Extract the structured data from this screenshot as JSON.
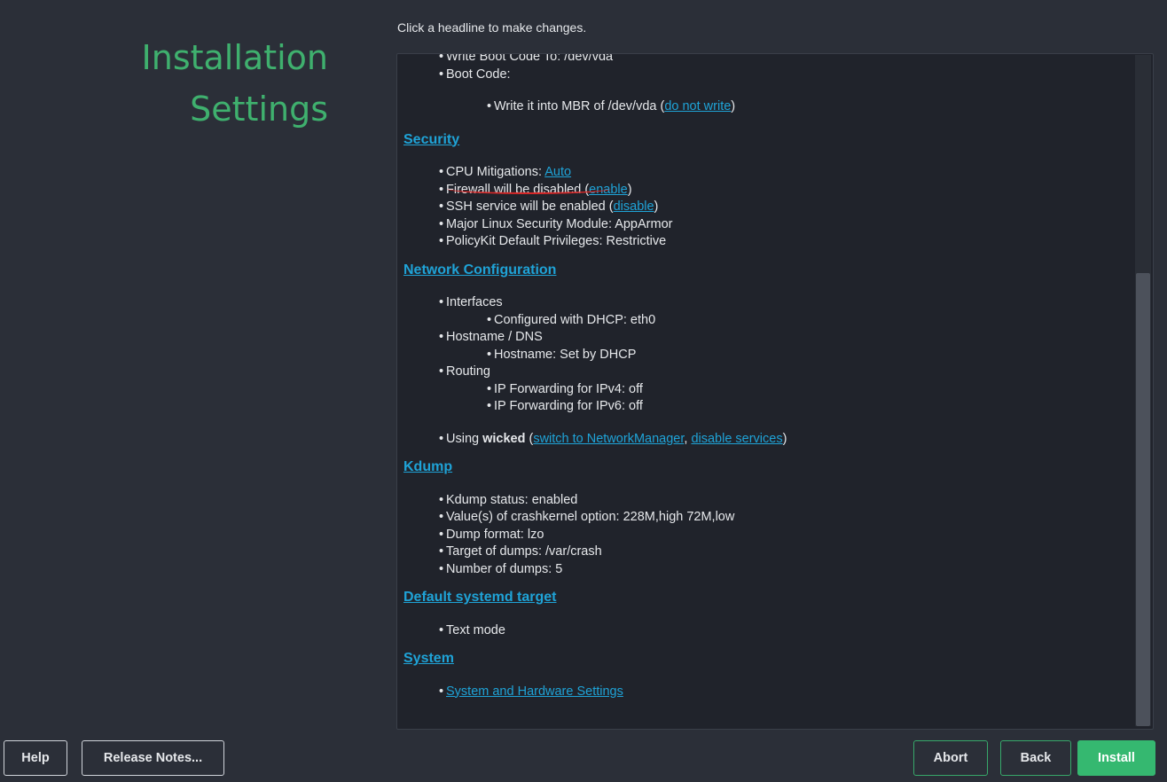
{
  "title": {
    "line1": "Installation",
    "line2": "Settings"
  },
  "hint": "Click a headline to make changes.",
  "boot": {
    "item1": "Write Boot Code To: /dev/vda",
    "item2": "Boot Code:",
    "mbr_prefix": "Write it into MBR of /dev/vda (",
    "mbr_link": "do not write",
    "mbr_suffix": ")"
  },
  "security": {
    "heading": "Security",
    "cpu_prefix": "CPU Mitigations: ",
    "cpu_link": "Auto",
    "firewall_prefix": "Firewall will be disabled (",
    "firewall_link": "enable",
    "firewall_suffix": ")",
    "ssh_prefix": "SSH service will be enabled (",
    "ssh_link": "disable",
    "ssh_suffix": ")",
    "lsm": "Major Linux Security Module: AppArmor",
    "polkit": "PolicyKit Default Privileges: Restrictive"
  },
  "network": {
    "heading": "Network Configuration",
    "interfaces": "Interfaces",
    "dhcp": "Configured with DHCP: eth0",
    "hostname_dns": "Hostname / DNS",
    "hostname": "Hostname: Set by DHCP",
    "routing": "Routing",
    "ipv4": "IP Forwarding for IPv4: off",
    "ipv6": "IP Forwarding for IPv6: off",
    "using_prefix": "Using ",
    "using_bold": "wicked",
    "using_open": " (",
    "link_nm": "switch to NetworkManager",
    "comma": ", ",
    "link_disable": "disable services",
    "using_close": ")"
  },
  "kdump": {
    "heading": "Kdump",
    "items": [
      "Kdump status: enabled",
      "Value(s) of crashkernel option: 228M,high 72M,low",
      "Dump format: lzo",
      "Target of dumps: /var/crash",
      "Number of dumps: 5"
    ]
  },
  "systemd": {
    "heading": "Default systemd target",
    "item": "Text mode"
  },
  "system": {
    "heading": "System",
    "link": "System and Hardware Settings"
  },
  "buttons": {
    "help": "Help",
    "release_notes": "Release Notes...",
    "abort": "Abort",
    "back": "Back",
    "install": "Install"
  }
}
